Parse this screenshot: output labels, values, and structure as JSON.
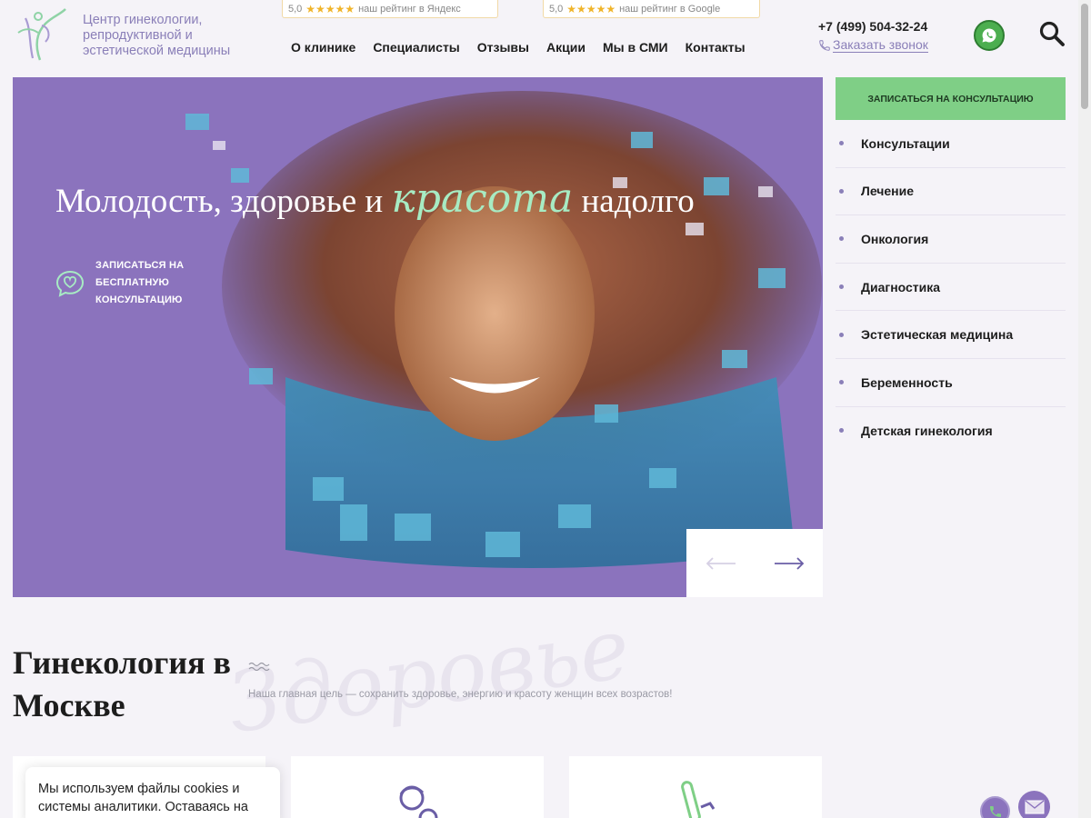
{
  "header": {
    "logo_text": "Центр гинекологии, репродуктивной и эстетической медицины",
    "ratings": [
      {
        "score": "5,0",
        "stars": "★★★★★",
        "label": "наш рейтинг в Яндекс"
      },
      {
        "score": "5,0",
        "stars": "★★★★★",
        "label": "наш рейтинг в Google"
      }
    ],
    "nav": [
      "О клинике",
      "Специалисты",
      "Отзывы",
      "Акции",
      "Мы в СМИ",
      "Контакты"
    ],
    "phone": "+7 (499) 504-32-24",
    "callback_label": "Заказать звонок",
    "icons": {
      "whatsapp": "whatsapp-icon",
      "search": "search-icon",
      "phone": "phone-icon"
    }
  },
  "hero": {
    "title_before": "Молодость, здоровье и ",
    "title_accent": "красота",
    "title_after": " надолго",
    "cta_label": "ЗАПИСАТЬСЯ НА БЕСПЛАТНУЮ КОНСУЛЬТАЦИЮ",
    "colors": {
      "background": "#8b73bd",
      "accent": "#a7ebc3"
    }
  },
  "sidebar": {
    "consult_button": "ЗАПИСАТЬСЯ НА КОНСУЛЬТАЦИЮ",
    "items": [
      {
        "label": "Консультации"
      },
      {
        "label": "Лечение"
      },
      {
        "label": "Онкология"
      },
      {
        "label": "Диагностика"
      },
      {
        "label": "Эстетическая медицина"
      },
      {
        "label": "Беременность"
      },
      {
        "label": "Детская гинекология"
      }
    ]
  },
  "section": {
    "title": "Гинекология в Москве",
    "watermark": "Здоровье",
    "description": "Наша главная цель — сохранить здоровье, энергию и красоту женщин всех возрастов!"
  },
  "cookie": {
    "text": "Мы используем файлы cookies и системы аналитики. Оставаясь на"
  },
  "colors": {
    "brand": "#8a7fb8",
    "button_green": "#7fcf86",
    "whatsapp": "#4cae4f"
  }
}
